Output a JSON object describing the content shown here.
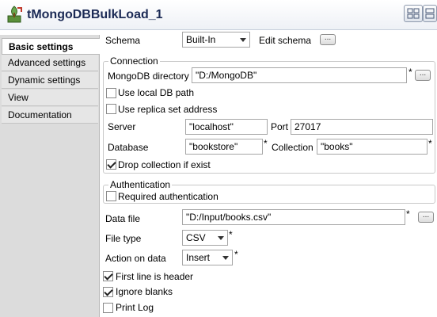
{
  "header": {
    "title": "tMongoDBBulkLoad_1"
  },
  "sidebar": {
    "items": [
      {
        "label": "Basic settings",
        "active": true
      },
      {
        "label": "Advanced settings"
      },
      {
        "label": "Dynamic settings"
      },
      {
        "label": "View"
      },
      {
        "label": "Documentation"
      }
    ]
  },
  "schema": {
    "label": "Schema",
    "value": "Built-In",
    "edit_label": "Edit schema",
    "edit_button": "..."
  },
  "connection": {
    "title": "Connection",
    "mongodb_directory": {
      "label": "MongoDB directory",
      "value": "\"D:/MongoDB\"",
      "required": "*",
      "button": "..."
    },
    "use_local_db_path": {
      "label": "Use local DB path",
      "checked": false
    },
    "use_replica_set": {
      "label": "Use replica set address",
      "checked": false
    },
    "server": {
      "label": "Server",
      "value": "\"localhost\""
    },
    "port": {
      "label": "Port",
      "value": "27017"
    },
    "database": {
      "label": "Database",
      "value": "\"bookstore\"",
      "required": "*"
    },
    "collection": {
      "label": "Collection",
      "value": "\"books\"",
      "required": "*"
    },
    "drop_collection": {
      "label": "Drop collection if exist",
      "checked": true
    }
  },
  "authentication": {
    "title": "Authentication",
    "required_auth": {
      "label": "Required authentication",
      "checked": false
    }
  },
  "data_file": {
    "label": "Data file",
    "value": "\"D:/Input/books.csv\"",
    "required": "*",
    "button": "..."
  },
  "file_type": {
    "label": "File type",
    "value": "CSV",
    "required": "*"
  },
  "action_on_data": {
    "label": "Action on data",
    "value": "Insert",
    "required": "*"
  },
  "first_line_header": {
    "label": "First line is header",
    "checked": true
  },
  "ignore_blanks": {
    "label": "Ignore blanks",
    "checked": true
  },
  "print_log": {
    "label": "Print Log",
    "checked": false
  },
  "colors": {
    "title": "#1b2a55",
    "sidebar_bg": "#dcdcdc",
    "border": "#a6a6a6"
  }
}
